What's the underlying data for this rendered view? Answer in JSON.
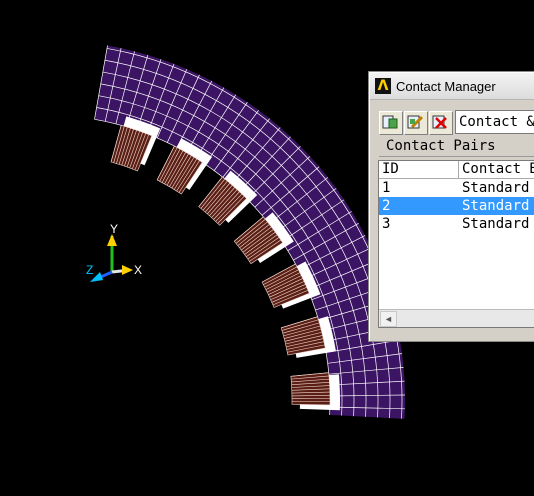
{
  "triad": {
    "x_label": "X",
    "y_label": "Y",
    "z_label": "Z"
  },
  "contact_manager": {
    "title": "Contact Manager",
    "toolbar": {
      "icons": [
        "contact-wizard-icon",
        "edit-contact-icon",
        "delete-contact-icon"
      ],
      "combo_value": "Contact &"
    },
    "section_label": "Contact Pairs",
    "columns": [
      "ID",
      "Contact B"
    ],
    "rows": [
      {
        "id": "1",
        "behavior": "Standard",
        "selected": false
      },
      {
        "id": "2",
        "behavior": "Standard",
        "selected": true
      },
      {
        "id": "3",
        "behavior": "Standard",
        "selected": false
      }
    ],
    "scroll_left_glyph": "◄"
  },
  "colors": {
    "background": "#000000",
    "mesh_fill": "#3c1464",
    "mesh_lines": "#ffffff",
    "contact_pad_fill": "#5a1e14",
    "selection": "#3399ff"
  }
}
